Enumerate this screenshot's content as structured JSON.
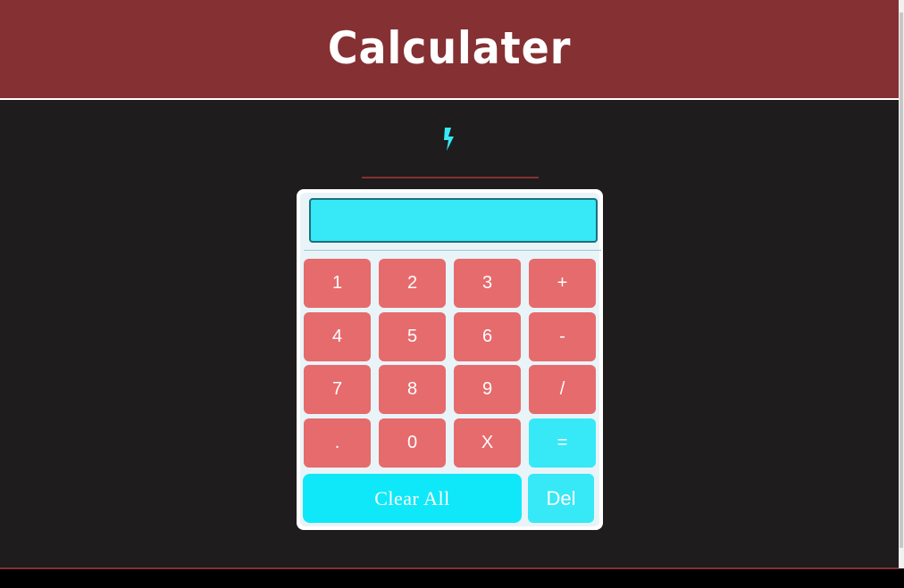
{
  "header": {
    "title": "Calculater"
  },
  "icon": {
    "name": "lightning-bolt-icon",
    "color": "#37e8f6"
  },
  "calculator": {
    "display_value": "",
    "keys": [
      {
        "label": "1"
      },
      {
        "label": "2"
      },
      {
        "label": "3"
      },
      {
        "label": "+"
      },
      {
        "label": "4"
      },
      {
        "label": "5"
      },
      {
        "label": "6"
      },
      {
        "label": "-"
      },
      {
        "label": "7"
      },
      {
        "label": "8"
      },
      {
        "label": "9"
      },
      {
        "label": "/"
      },
      {
        "label": "."
      },
      {
        "label": "0"
      },
      {
        "label": "X"
      },
      {
        "label": "="
      }
    ],
    "clear_label": "Clear All",
    "delete_label": "Del"
  },
  "colors": {
    "header_bg": "#853033",
    "page_bg": "#1e1c1d",
    "key_bg": "#e66b6d",
    "accent": "#37e8f6"
  }
}
